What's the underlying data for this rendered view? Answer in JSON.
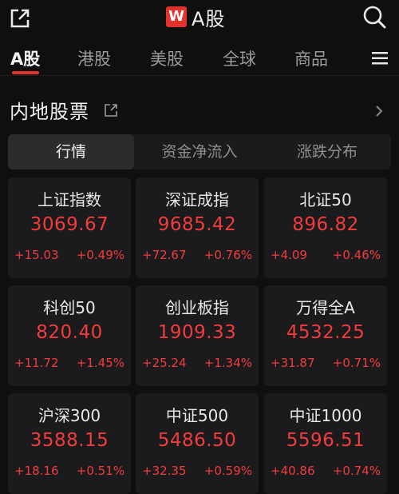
{
  "header": {
    "logo_letter": "W",
    "title": "A股",
    "brand_color": "#e2322e",
    "icons": [
      "share-icon",
      "search-icon"
    ]
  },
  "tabs": [
    {
      "label": "A股",
      "active": true
    },
    {
      "label": "港股",
      "active": false
    },
    {
      "label": "美股",
      "active": false
    },
    {
      "label": "全球",
      "active": false
    },
    {
      "label": "商品",
      "active": false
    }
  ],
  "section": {
    "title": "内地股票",
    "icons": [
      "external-link-icon",
      "chevron-right-icon"
    ]
  },
  "segments": [
    {
      "label": "行情",
      "active": true
    },
    {
      "label": "资金净流入",
      "active": false
    },
    {
      "label": "涨跌分布",
      "active": false
    }
  ],
  "indices": [
    {
      "name": "上证指数",
      "value": "3069.67",
      "change": "+15.03",
      "percent": "+0.49%"
    },
    {
      "name": "深证成指",
      "value": "9685.42",
      "change": "+72.67",
      "percent": "+0.76%"
    },
    {
      "name": "北证50",
      "value": "896.82",
      "change": "+4.09",
      "percent": "+0.46%"
    },
    {
      "name": "科创50",
      "value": "820.40",
      "change": "+11.72",
      "percent": "+1.45%"
    },
    {
      "name": "创业板指",
      "value": "1909.33",
      "change": "+25.24",
      "percent": "+1.34%"
    },
    {
      "name": "万得全A",
      "value": "4532.25",
      "change": "+31.87",
      "percent": "+0.71%"
    },
    {
      "name": "沪深300",
      "value": "3588.15",
      "change": "+18.16",
      "percent": "+0.51%"
    },
    {
      "name": "中证500",
      "value": "5486.50",
      "change": "+32.35",
      "percent": "+0.59%"
    },
    {
      "name": "中证1000",
      "value": "5596.51",
      "change": "+40.86",
      "percent": "+0.74%"
    }
  ],
  "colors": {
    "up": "#f23b3b",
    "background": "#0f0f10",
    "card": "#1b1b1d"
  }
}
